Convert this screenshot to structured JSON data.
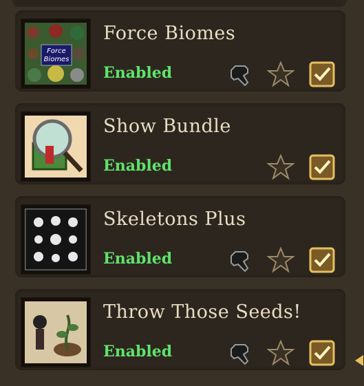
{
  "mods": [
    {
      "title": "Force  Biomes",
      "status": "Enabled",
      "thumb_text_1": "Force",
      "thumb_text_2": "Biomes",
      "has_config": true
    },
    {
      "title": "Show Bundle",
      "status": "Enabled",
      "has_config": false
    },
    {
      "title": "Skeletons Plus",
      "status": "Enabled",
      "has_config": true
    },
    {
      "title": "Throw Those Seeds!",
      "status": "Enabled",
      "has_config": true
    }
  ],
  "icons": {
    "config": "wrench-icon",
    "favorite": "star-icon",
    "enabled": "checkbox-checked-icon"
  },
  "colors": {
    "status": "#5fe36c",
    "title": "#e8dcc4",
    "accent": "#e6c061"
  }
}
